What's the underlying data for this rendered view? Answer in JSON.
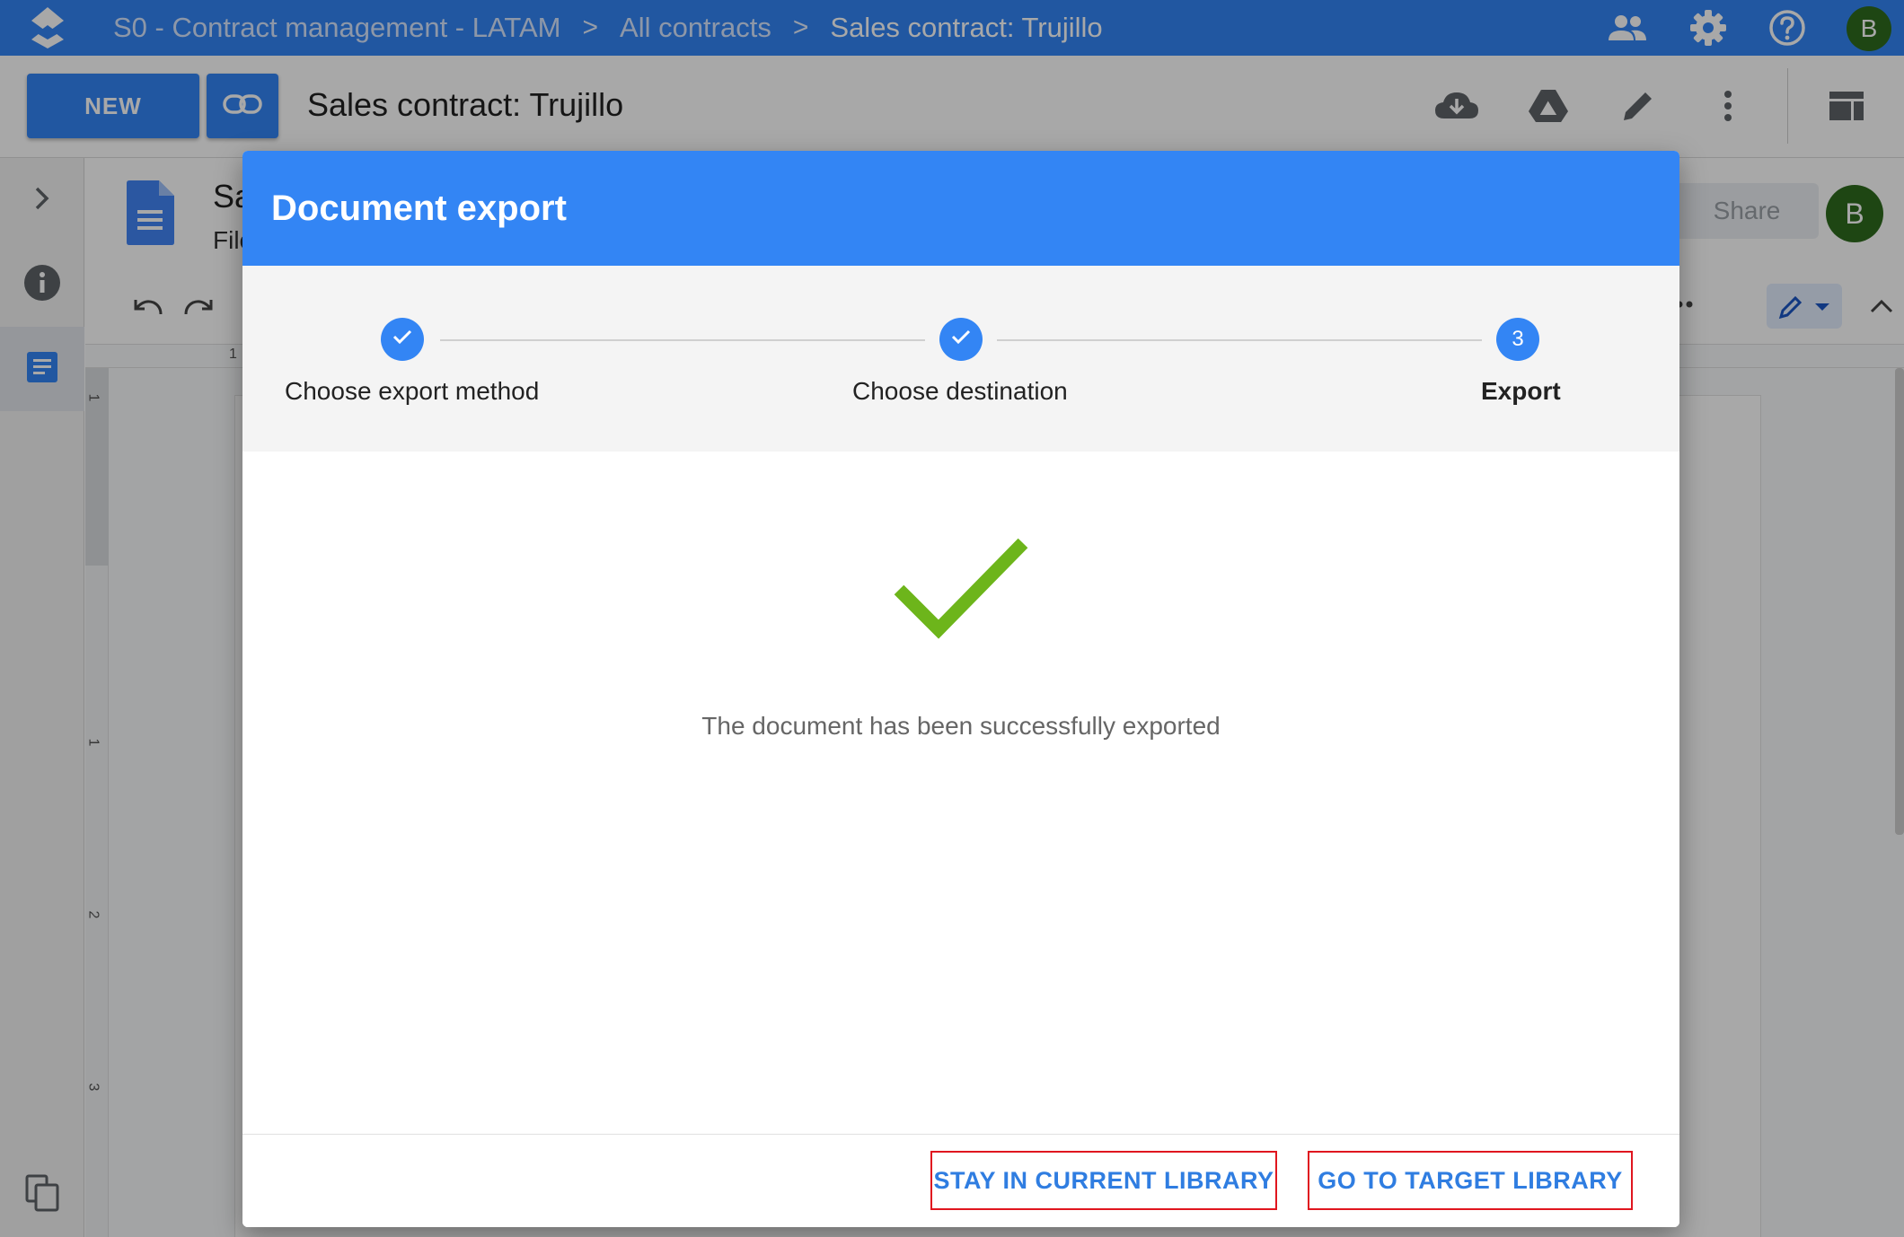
{
  "topbar": {
    "breadcrumbs": [
      "S0 - Contract management - LATAM",
      "All contracts",
      "Sales contract: Trujillo"
    ],
    "separator": ">",
    "avatar_initial": "B",
    "icons": [
      "app-logo-icon",
      "people-icon",
      "settings-gear-icon",
      "help-icon"
    ]
  },
  "toolbar": {
    "new_label": "NEW",
    "title": "Sales contract: Trujillo",
    "icons": [
      "link-icon",
      "cloud-download-icon",
      "google-drive-icon",
      "edit-pencil-icon",
      "more-vert-icon",
      "layout-icon"
    ]
  },
  "rail": {
    "icons": [
      "chevron-right-icon",
      "info-icon",
      "document-icon",
      "copy-icon"
    ]
  },
  "background_doc": {
    "name_partial": "Sa",
    "menu_partial": "File",
    "share_label": "Share",
    "avatar_initial": "B",
    "ruler_marks": [
      "1",
      "1",
      "1",
      "2",
      "3"
    ]
  },
  "dialog": {
    "title": "Document export",
    "steps": [
      {
        "label": "Choose export method",
        "state": "done"
      },
      {
        "label": "Choose destination",
        "state": "done"
      },
      {
        "label": "Export",
        "number": "3",
        "state": "active"
      }
    ],
    "success_message": "The document has been successfully exported",
    "buttons": {
      "stay": "STAY IN CURRENT LIBRARY",
      "go": "GO TO TARGET LIBRARY"
    }
  },
  "colors": {
    "brand_blue": "#3385f4",
    "success_green": "#6db51b",
    "avatar_green": "#2e6b1d",
    "highlight_red": "#e0161f"
  }
}
